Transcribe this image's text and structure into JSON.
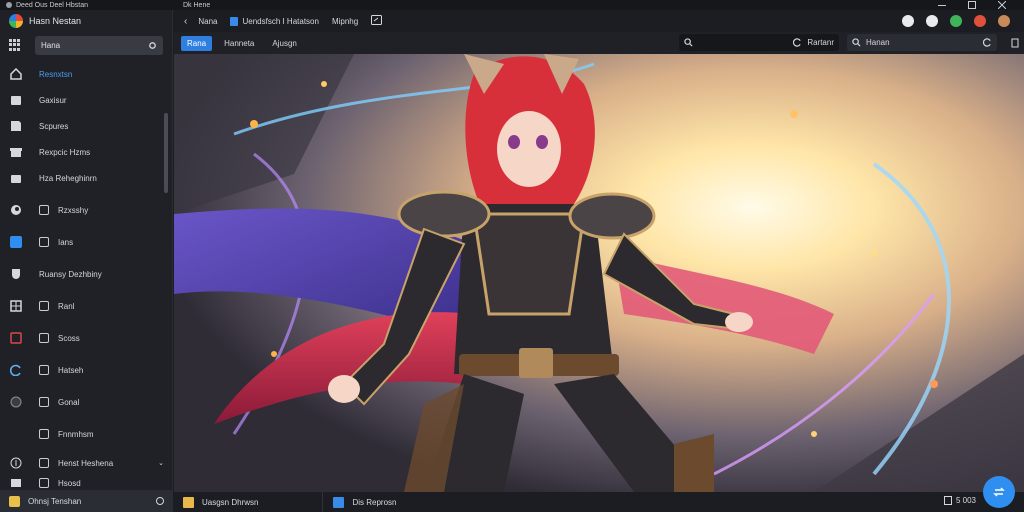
{
  "window": {
    "title": "Deed Ous Deel Hbstan",
    "tab_title": "Dk Hene"
  },
  "sidebar": {
    "app_name": "Hasn Nestan",
    "search_value": "Hana",
    "items": [
      {
        "label": "Resnxtsn",
        "icon": "home-icon",
        "active": true
      },
      {
        "label": "Gaxisur",
        "icon": "folder-icon"
      },
      {
        "label": "Scpures",
        "icon": "edit-icon"
      },
      {
        "label": "Rexpcic Hzms",
        "icon": "gift-icon"
      },
      {
        "label": "Hza Reheghinrn",
        "icon": "bag-icon"
      },
      {
        "label": "Rzxsshy",
        "icon": "globe-icon"
      },
      {
        "label": "Ians",
        "icon": "blue-square-icon"
      },
      {
        "label": "Ruansy Dezhbiny",
        "icon": "cup-icon"
      },
      {
        "label": "Ranl",
        "icon": "grid-icon"
      },
      {
        "label": "Scoss",
        "icon": "red-square-icon"
      },
      {
        "label": "Hatseh",
        "icon": "refresh-icon"
      },
      {
        "label": "Gonal",
        "icon": "circle-icon"
      },
      {
        "label": "Fnnmhsm",
        "icon": "square-icon"
      },
      {
        "label": "Henst Heshena",
        "icon": "upload-icon"
      },
      {
        "label": "Hsosd",
        "icon": "list-icon"
      }
    ],
    "footer_label": "Ohnsj Tenshan"
  },
  "nav": {
    "crumbs": [
      "Nana",
      "Uendsfsch I Hatatson",
      "Mipnhg"
    ],
    "back_label": "‹"
  },
  "toolbar": {
    "buttons": [
      "Rana",
      "Hanneta",
      "Ajusgn"
    ],
    "search_label": "Rartanr",
    "search2_value": "Hanan"
  },
  "status": {
    "file1": "Uasgsn Dhrwsn",
    "file2": "Dis Reprosn",
    "right": "5 003"
  },
  "colors": {
    "accent": "#2f7fe0",
    "active_text": "#4b9cf5"
  }
}
